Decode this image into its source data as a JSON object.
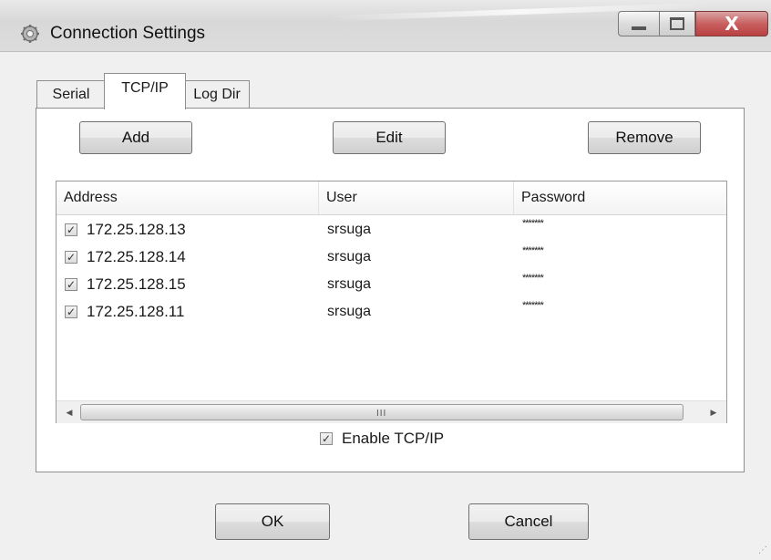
{
  "window": {
    "title": "Connection Settings",
    "close_glyph": "X"
  },
  "tabs": [
    {
      "label": "Serial",
      "active": false
    },
    {
      "label": "TCP/IP",
      "active": true
    },
    {
      "label": "Log Dir",
      "active": false
    }
  ],
  "toolbar": {
    "add_label": "Add",
    "edit_label": "Edit",
    "remove_label": "Remove"
  },
  "connections": {
    "columns": [
      "Address",
      "User",
      "Password"
    ],
    "rows": [
      {
        "address": "172.25.128.13",
        "user": "srsuga",
        "password": "*******",
        "checked": true
      },
      {
        "address": "172.25.128.14",
        "user": "srsuga",
        "password": "*******",
        "checked": true
      },
      {
        "address": "172.25.128.15",
        "user": "srsuga",
        "password": "*******",
        "checked": true
      },
      {
        "address": "172.25.128.11",
        "user": "srsuga",
        "password": "*******",
        "checked": true
      }
    ]
  },
  "enable_tcpip": {
    "label": "Enable TCP/IP",
    "checked": true
  },
  "dialog": {
    "ok_label": "OK",
    "cancel_label": "Cancel"
  },
  "icons": {
    "app": "gear-icon",
    "checkbox_mark": "check-icon",
    "scroll_left": "scroll-left-arrow-icon",
    "scroll_right": "scroll-right-arrow-icon",
    "scroll_grip": "scroll-grip-icon"
  },
  "colors": {
    "close_button": "#c96060",
    "window_background": "#f0f0f0"
  }
}
